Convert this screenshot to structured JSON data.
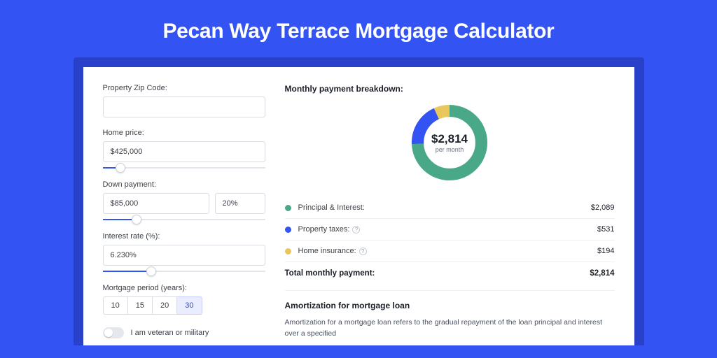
{
  "hero_title": "Pecan Way Terrace Mortgage Calculator",
  "form": {
    "zip_label": "Property Zip Code:",
    "zip_value": "",
    "home_price_label": "Home price:",
    "home_price_value": "$425,000",
    "home_price_slider_pct": 11,
    "down_payment_label": "Down payment:",
    "down_payment_value": "$85,000",
    "down_payment_pct_value": "20%",
    "down_payment_slider_pct": 21,
    "rate_label": "Interest rate (%):",
    "rate_value": "6.230%",
    "rate_slider_pct": 30,
    "period_label": "Mortgage period (years):",
    "periods": [
      "10",
      "15",
      "20",
      "30"
    ],
    "period_selected": "30",
    "veteran_label": "I am veteran or military",
    "veteran_on": false
  },
  "breakdown": {
    "title": "Monthly payment breakdown:",
    "center_amount": "$2,814",
    "center_sub": "per month",
    "rows": [
      {
        "color": "green",
        "label": "Principal & Interest:",
        "info": false,
        "value": "$2,089"
      },
      {
        "color": "blue",
        "label": "Property taxes:",
        "info": true,
        "value": "$531"
      },
      {
        "color": "yellow",
        "label": "Home insurance:",
        "info": true,
        "value": "$194"
      }
    ],
    "total_label": "Total monthly payment:",
    "total_value": "$2,814"
  },
  "chart_data": {
    "type": "pie",
    "title": "Monthly payment breakdown",
    "series": [
      {
        "name": "Principal & Interest",
        "value": 2089,
        "color": "#49a887"
      },
      {
        "name": "Property taxes",
        "value": 531,
        "color": "#3353f3"
      },
      {
        "name": "Home insurance",
        "value": 194,
        "color": "#e9c75d"
      }
    ],
    "total": 2814,
    "center_label": "$2,814 per month"
  },
  "amort": {
    "title": "Amortization for mortgage loan",
    "text": "Amortization for a mortgage loan refers to the gradual repayment of the loan principal and interest over a specified"
  }
}
